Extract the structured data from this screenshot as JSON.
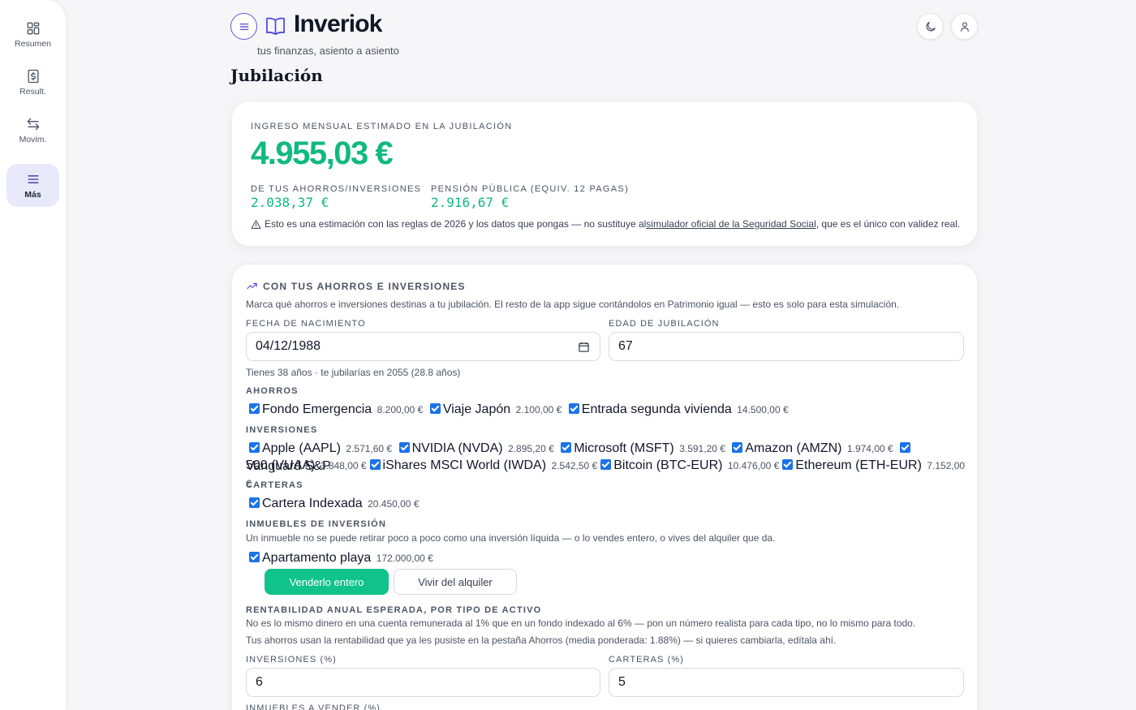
{
  "sidebar": {
    "items": [
      {
        "label": "Resumen",
        "icon": "dashboard-icon"
      },
      {
        "label": "Result.",
        "icon": "dollar-document-icon"
      },
      {
        "label": "Movim.",
        "icon": "arrows-exchange-icon"
      },
      {
        "label": "Más",
        "icon": "menu-lines-icon",
        "active": true
      }
    ]
  },
  "header": {
    "app_name": "Inveriok",
    "tagline": "tus finanzas, asiento a asiento",
    "page_title": "Jubilación"
  },
  "summary": {
    "eyebrow": "INGRESO MENSUAL ESTIMADO EN LA JUBILACIÓN",
    "total": "4.955,03 €",
    "savings_label": "DE TUS AHORROS/INVERSIONES",
    "savings_value": "2.038,37 €",
    "pension_label": "PENSIÓN PÚBLICA (EQUIV. 12 PAGAS)",
    "pension_value": "2.916,67 €",
    "disclaimer_before": "Esto es una estimación con las reglas de 2026 y los datos que pongas — no sustituye al ",
    "disclaimer_link": "simulador oficial de la Seguridad Social",
    "disclaimer_after": ", que es el único con validez real."
  },
  "savings_section": {
    "title": "CON TUS AHORROS E INVERSIONES",
    "intro": "Marca qué ahorros e inversiones destinas a tu jubilación. El resto de la app sigue contándolos en Patrimonio igual — esto es solo para esta simulación.",
    "birth_label": "FECHA DE NACIMIENTO",
    "birth_value": "04/12/1988",
    "retire_label": "EDAD DE JUBILACIÓN",
    "retire_value": "67",
    "age_note": "Tienes 38 años · te jubilarías en 2055 (28.8 años)",
    "ahorros_title": "AHORROS",
    "ahorros": [
      {
        "name": "Fondo Emergencia",
        "amount": "8.200,00 €"
      },
      {
        "name": "Viaje Japón",
        "amount": "2.100,00 €"
      },
      {
        "name": "Entrada segunda vivienda",
        "amount": "14.500,00 €"
      }
    ],
    "inversiones_title": "INVERSIONES",
    "inversiones_line1": [
      {
        "name": "Apple (AAPL)",
        "amount": "2.571,60 €"
      },
      {
        "name": "NVIDIA (NVDA)",
        "amount": "2.895,20 €"
      },
      {
        "name": "Microsoft (MSFT)",
        "amount": "3.591,20 €"
      },
      {
        "name": "Amazon (AMZN)",
        "amount": "1.974,00 €"
      }
    ],
    "vanguard_name_a": "Vanguard S&P",
    "vanguard_name_b": "500 (VUAA)",
    "vanguard_amount": "3.848,00 €",
    "inversiones_line2": [
      {
        "name": "iShares MSCI World (IWDA)",
        "amount": "2.542,50 €"
      },
      {
        "name": "Bitcoin (BTC-EUR)",
        "amount": "10.476,00 €"
      },
      {
        "name": "Ethereum (ETH-EUR)",
        "amount": "7.152,00 €"
      }
    ],
    "carteras_title": "CARTERAS",
    "carteras": [
      {
        "name": "Cartera Indexada",
        "amount": "20.450,00 €"
      }
    ],
    "inmuebles_title": "INMUEBLES DE INVERSIÓN",
    "inmuebles_note": "Un inmueble no se puede retirar poco a poco como una inversión líquida — o lo vendes entero, o vives del alquiler que da.",
    "inmuebles": [
      {
        "name": "Apartamento playa",
        "amount": "172.000,00 €"
      }
    ],
    "sell_label": "Venderlo entero",
    "rent_label": "Vivir del alquiler",
    "rent_title": "RENTABILIDAD ANUAL ESPERADA, POR TIPO DE ACTIVO",
    "rent_note1": "No es lo mismo dinero en una cuenta remunerada al 1% que en un fondo indexado al 6% — pon un número realista para cada tipo, no lo mismo para todo.",
    "rent_note2": "Tus ahorros usan la rentabilidad que ya les pusiste en la pestaña Ahorros (media ponderada: 1.88%) — si quieres cambiarla, edítala ahí.",
    "inv_pct_label": "INVERSIONES (%)",
    "inv_pct_value": "6",
    "cart_pct_label": "CARTERAS (%)",
    "cart_pct_value": "5",
    "inm_pct_label": "INMUEBLES A VENDER (%)"
  },
  "colors": {
    "accent": "#4f46e5",
    "positive": "#10b981",
    "active_nav_bg": "#e8e9fb"
  }
}
